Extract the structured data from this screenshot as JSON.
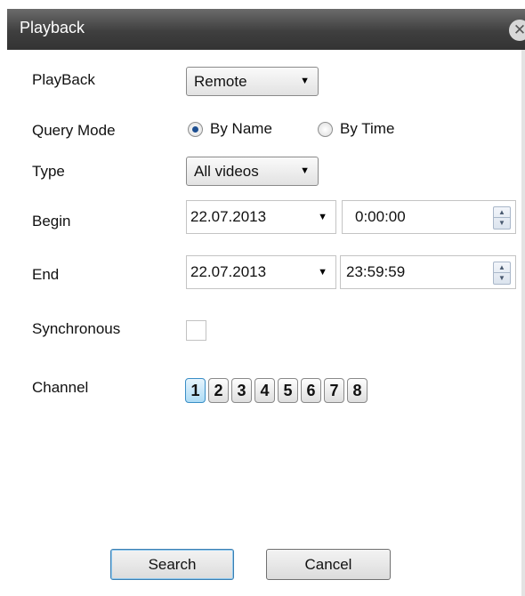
{
  "window": {
    "title": "Playback"
  },
  "labels": {
    "playback": "PlayBack",
    "query_mode": "Query Mode",
    "type": "Type",
    "begin": "Begin",
    "end": "End",
    "synchronous": "Synchronous",
    "channel": "Channel"
  },
  "playback_select": {
    "value": "Remote"
  },
  "query_mode": {
    "options": [
      {
        "label": "By Name",
        "checked": true
      },
      {
        "label": "By Time",
        "checked": false
      }
    ]
  },
  "type_select": {
    "value": "All videos"
  },
  "begin": {
    "date": "22.07.2013",
    "time": "0:00:00"
  },
  "end": {
    "date": "22.07.2013",
    "time": "23:59:59"
  },
  "synchronous": {
    "checked": false
  },
  "channels": {
    "items": [
      "1",
      "2",
      "3",
      "4",
      "5",
      "6",
      "7",
      "8"
    ],
    "selected": "1"
  },
  "buttons": {
    "search": "Search",
    "cancel": "Cancel"
  },
  "icons": {
    "close": "close-icon",
    "dropdown": "chevron-down-icon",
    "spin_up": "spin-up-icon",
    "spin_down": "spin-down-icon"
  }
}
